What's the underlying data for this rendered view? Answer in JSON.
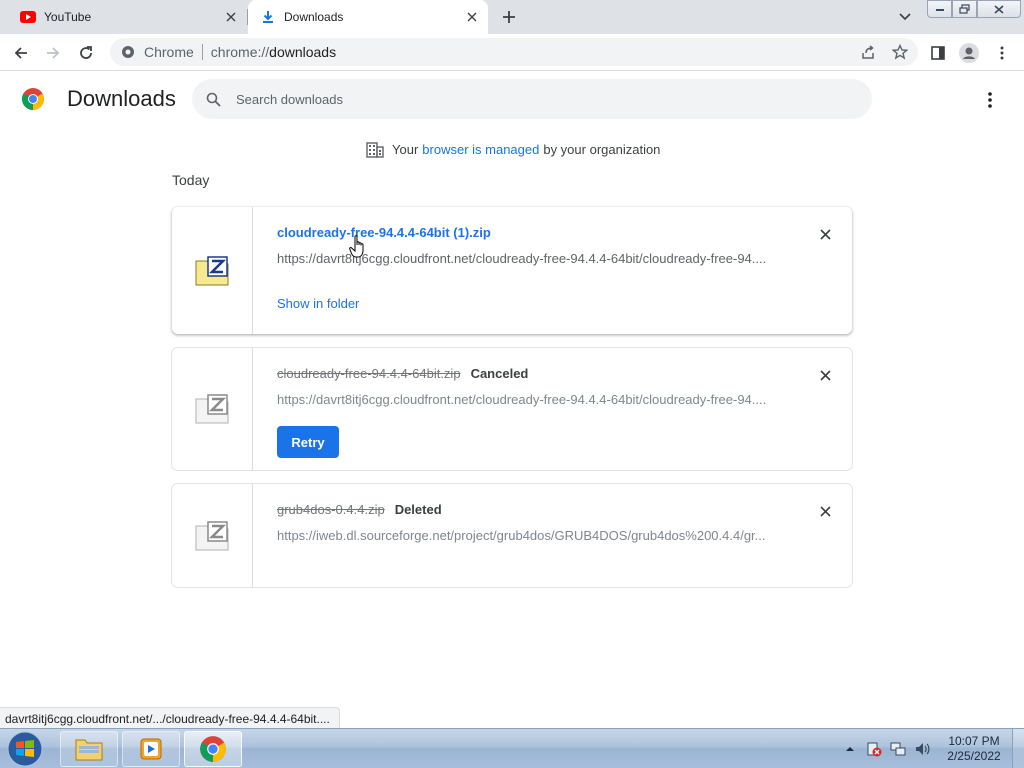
{
  "tabs": [
    {
      "title": "YouTube",
      "icon": "youtube-icon",
      "active": false
    },
    {
      "title": "Downloads",
      "icon": "download-icon",
      "active": true
    }
  ],
  "toolbar": {
    "scheme_label": "Chrome",
    "url_scheme": "chrome://",
    "url_path": "downloads"
  },
  "page": {
    "title": "Downloads",
    "search_placeholder": "Search downloads"
  },
  "managed_notice": {
    "prefix": "Your",
    "link": "browser is managed",
    "suffix": "by your organization"
  },
  "section_date": "Today",
  "downloads": [
    {
      "file_name": "cloudready-free-94.4.4-64bit (1).zip",
      "url": "https://davrt8itj6cgg.cloudfront.net/cloudready-free-94.4.4-64bit/cloudready-free-94....",
      "status": "",
      "action_label": "Show in folder",
      "icon": "zip-file-icon"
    },
    {
      "file_name": "cloudready-free-94.4.4-64bit.zip",
      "url": "https://davrt8itj6cgg.cloudfront.net/cloudready-free-94.4.4-64bit/cloudready-free-94....",
      "status": "Canceled",
      "action_label": "Retry",
      "icon": "zip-file-icon"
    },
    {
      "file_name": "grub4dos-0.4.4.zip",
      "url": "https://iweb.dl.sourceforge.net/project/grub4dos/GRUB4DOS/grub4dos%200.4.4/gr...",
      "status": "Deleted",
      "action_label": "",
      "icon": "zip-file-icon"
    }
  ],
  "status_bubble": "davrt8itj6cgg.cloudfront.net/.../cloudready-free-94.4.4-64bit....",
  "taskbar": {
    "time": "10:07 PM",
    "date": "2/25/2022"
  },
  "colors": {
    "accent": "#1a73e8",
    "tabstrip": "#dee1e6",
    "omnibox": "#f1f3f4"
  }
}
